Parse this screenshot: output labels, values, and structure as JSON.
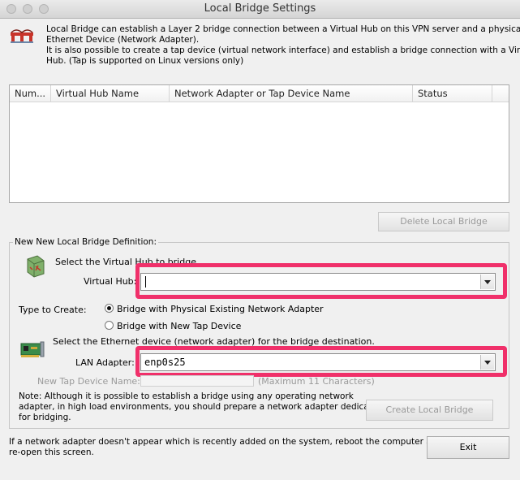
{
  "window": {
    "title": "Local Bridge Settings"
  },
  "intro": {
    "lines": [
      "Local Bridge can establish a Layer 2 bridge connection between a Virtual Hub on this VPN server and a physical",
      "Ethernet Device (Network Adapter).",
      "It is also possible to create a tap device (virtual network interface) and establish a bridge connection with a Virtual",
      "Hub. (Tap is supported on Linux versions only)"
    ]
  },
  "bridge_list": {
    "columns": [
      "Num...",
      "Virtual Hub Name",
      "Network Adapter or Tap Device Name",
      "Status"
    ],
    "rows": []
  },
  "buttons": {
    "delete": "Delete Local Bridge",
    "create": "Create Local Bridge",
    "exit": "Exit"
  },
  "definition": {
    "group_label": "New New Local Bridge Definition:",
    "select_hub_text": "Select the Virtual Hub to bridge.",
    "virtual_hub_label": "Virtual Hub:",
    "virtual_hub_value": "",
    "type_label": "Type to Create:",
    "radio_physical": "Bridge with Physical Existing Network Adapter",
    "radio_tap": "Bridge with New Tap Device",
    "select_eth_text": "Select the Ethernet device (network adapter) for the bridge destination.",
    "lan_adapter_label": "LAN Adapter:",
    "lan_adapter_value": "enp0s25",
    "tap_name_label": "New Tap Device Name:",
    "tap_name_hint": "(Maximum 11 Characters)",
    "note_lines": [
      "Note: Although it is possible to establish a bridge using any operating network",
      "adapter, in high load environments, you should prepare a network adapter dedicated",
      "for bridging."
    ]
  },
  "footer": {
    "lines": [
      "If a network adapter doesn't appear which is recently added on the system, reboot the computer and",
      "re-open this screen."
    ]
  },
  "colors": {
    "highlight": "#f0306a"
  }
}
